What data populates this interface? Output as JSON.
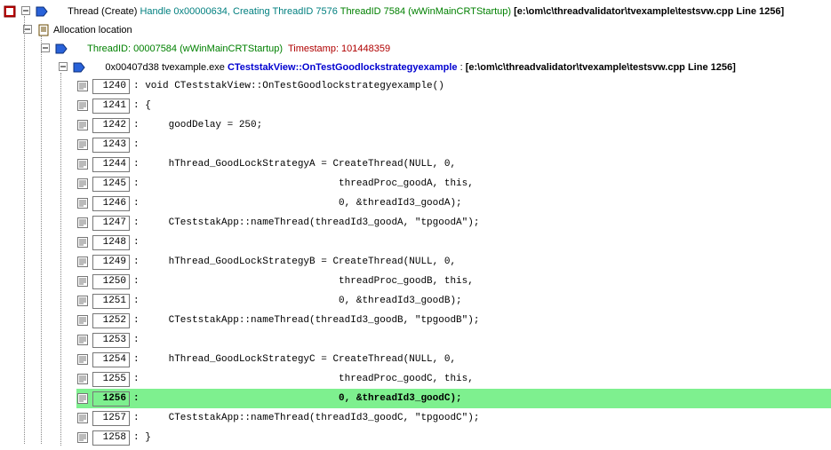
{
  "root": {
    "label_prefix": "Thread (Create) ",
    "handle": "Handle 0x00000634, Creating ThreadID 7576 ",
    "thread_id": "ThreadID 7584 (wWinMainCRTStartup) ",
    "path": "[e:\\om\\c\\threadvalidator\\tvexample\\testsvw.cpp Line 1256]"
  },
  "alloc": {
    "label": "Allocation location"
  },
  "tid_line": {
    "tid": "ThreadID: 00007584 (wWinMainCRTStartup)  ",
    "ts": "Timestamp: 101448359"
  },
  "frame": {
    "addr": "0x00407d38 ",
    "module": "tvexample.exe ",
    "symbol": "CTeststakView::OnTestGoodlockstrategyexample",
    "sep": " : ",
    "path": "[e:\\om\\c\\threadvalidator\\tvexample\\testsvw.cpp Line 1256]"
  },
  "src": {
    "highlight_line": 1256,
    "lines": [
      {
        "n": 1240,
        "t": "void CTeststakView::OnTestGoodlockstrategyexample()"
      },
      {
        "n": 1241,
        "t": "{"
      },
      {
        "n": 1242,
        "t": "    goodDelay = 250;"
      },
      {
        "n": 1243,
        "t": ""
      },
      {
        "n": 1244,
        "t": "    hThread_GoodLockStrategyA = CreateThread(NULL, 0,"
      },
      {
        "n": 1245,
        "t": "                                 threadProc_goodA, this,"
      },
      {
        "n": 1246,
        "t": "                                 0, &threadId3_goodA);"
      },
      {
        "n": 1247,
        "t": "    CTeststakApp::nameThread(threadId3_goodA, \"tpgoodA\");"
      },
      {
        "n": 1248,
        "t": ""
      },
      {
        "n": 1249,
        "t": "    hThread_GoodLockStrategyB = CreateThread(NULL, 0,"
      },
      {
        "n": 1250,
        "t": "                                 threadProc_goodB, this,"
      },
      {
        "n": 1251,
        "t": "                                 0, &threadId3_goodB);"
      },
      {
        "n": 1252,
        "t": "    CTeststakApp::nameThread(threadId3_goodB, \"tpgoodB\");"
      },
      {
        "n": 1253,
        "t": ""
      },
      {
        "n": 1254,
        "t": "    hThread_GoodLockStrategyC = CreateThread(NULL, 0,"
      },
      {
        "n": 1255,
        "t": "                                 threadProc_goodC, this,"
      },
      {
        "n": 1256,
        "t": "                                 0, &threadId3_goodC);"
      },
      {
        "n": 1257,
        "t": "    CTeststakApp::nameThread(threadId3_goodC, \"tpgoodC\");"
      },
      {
        "n": 1258,
        "t": "}"
      }
    ]
  }
}
